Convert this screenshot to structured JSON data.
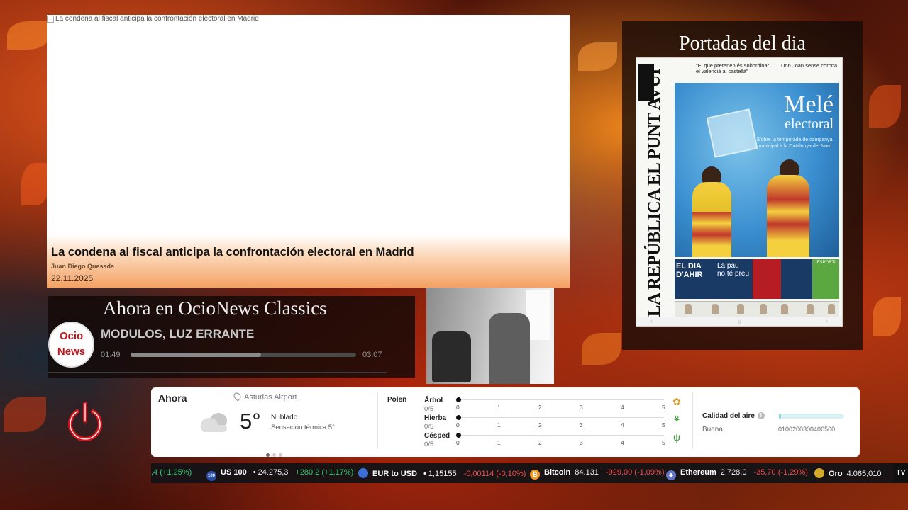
{
  "headline": {
    "image_alt": "La condena al fiscal anticipa la confrontación electoral en Madrid",
    "title": "La condena al fiscal anticipa la confrontación electoral en Madrid",
    "author": "Juan Diego Quesada",
    "date": "22.11.2025"
  },
  "portadas": {
    "title": "Portadas del dia",
    "newspaper": {
      "masthead": "LA REPÚBLICA EL PUNT AVUI",
      "top_left": "\"El que pretenen és subordinar el valencià al castellà\"",
      "top_right": "Don Joan sense corona",
      "cover_title_1": "Melé",
      "cover_title_2": "electoral",
      "cover_subtitle": "S'obre la temporada de campanya municipal a la Catalunya del Nord",
      "bottom_left_1": "EL DIA",
      "bottom_left_2": "D'AHIR",
      "bottom_mid_1": "La pau",
      "bottom_mid_2": "no té preu",
      "bottom_right": "L'ESPORTIU"
    }
  },
  "radio": {
    "title": "Ahora en OcioNews Classics",
    "logo_top": "Ocio",
    "logo_bottom": "News",
    "song": "MODULOS, LUZ ERRANTE",
    "time_current": "01:49",
    "time_total": "03:07",
    "progress": 0.58
  },
  "weather": {
    "now_label": "Ahora",
    "location": "Asturias Airport",
    "temperature": "5°",
    "condition": "Nublado",
    "feels_like": "Sensación térmica 5°",
    "pollen_label": "Polen",
    "pollen": [
      {
        "name": "Árbol",
        "score": "0/5",
        "icon": "tree-pollen-icon"
      },
      {
        "name": "Hierba",
        "score": "0/5",
        "icon": "grass-pollen-icon"
      },
      {
        "name": "Césped",
        "score": "0/5",
        "icon": "lawn-pollen-icon"
      }
    ],
    "pollen_ticks": [
      "0",
      "1",
      "2",
      "3",
      "4",
      "5"
    ],
    "air_quality_label": "Calidad del aire",
    "air_quality_status": "Buena",
    "air_quality_scale": "0100200300400500",
    "air_quality_level": 0.03
  },
  "ticker": [
    {
      "name": "",
      "price": "",
      "change": ",4 (+1,25%)",
      "direction": "up",
      "icon": ""
    },
    {
      "name": "US 100",
      "price": "24.275,3",
      "change": "+280,2 (+1,17%)",
      "direction": "up",
      "icon": "100",
      "color": "#2a4fa8"
    },
    {
      "name": "EUR to USD",
      "price": "1,15155",
      "change": "-0,00114 (-0,10%)",
      "direction": "down",
      "icon": "",
      "color": "#3c6fd6"
    },
    {
      "name": "Bitcoin",
      "price": "84.131",
      "change": "-929,00 (-1,09%)",
      "direction": "down",
      "icon": "₿",
      "color": "#f2991c"
    },
    {
      "name": "Ethereum",
      "price": "2.728,0",
      "change": "-35,70 (-1,29%)",
      "direction": "down",
      "icon": "◆",
      "color": "#6275c6"
    },
    {
      "name": "Oro",
      "price": "4.065,010",
      "change": "",
      "direction": "up",
      "icon": "",
      "color": "#d4a92a"
    }
  ],
  "ticker_brand": "TV",
  "colors": {
    "accent_orange": "#f4a162",
    "power_red": "#d3141c",
    "ticker_up": "#2ecc71",
    "ticker_down": "#ef4d4d"
  }
}
